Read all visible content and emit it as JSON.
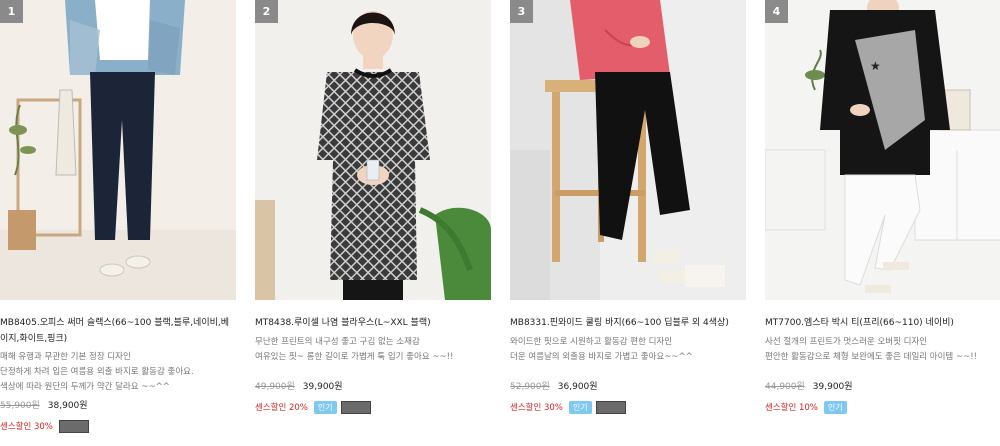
{
  "products": [
    {
      "rank": "1",
      "title": "MB8405.오피스 써머 슬랙스(66~100 블랙,블루,네이비,베이지,화이트,핑크)",
      "desc": [
        "매해 유행과 무관한 기본 정장 디자인",
        "단정하게 차려 입은 여름용 외출 바지로 활동감 좋아요.",
        "색상에 따라 원단의 두께가 약간 달라요 ~~^^"
      ],
      "old_price": "55,900원",
      "price": "38,900원",
      "discount": "센스할인 30%",
      "popular": "",
      "image": "woman-in-navy-slacks"
    },
    {
      "rank": "2",
      "title": "MT8438.루이셀 나염 블라우스(L~XXL 블랙)",
      "desc": [
        "무난한 프린트의 내구성 좋고 구김 없는 소재감",
        "여유있는 핏~ 롱한 길이로 가볍게 툭 입기 좋아요 ~~!!"
      ],
      "old_price": "49,900원",
      "price": "39,900원",
      "discount": "센스할인 20%",
      "popular": "인기",
      "image": "woman-in-checked-blouse"
    },
    {
      "rank": "3",
      "title": "MB8331.핀와이드 쿨링 바지(66~100 딥블루 외 4색상)",
      "desc": [
        "와이드한 핏으로 시원하고 활동감 편한 디자인",
        "더운 여름날의 외출용 바지로 가볍고 좋아요~~^^"
      ],
      "old_price": "52,900원",
      "price": "36,900원",
      "discount": "센스할인 30%",
      "popular": "인기",
      "image": "woman-in-wide-black-pants"
    },
    {
      "rank": "4",
      "title": "MT7700.엠스타 박시 티(프리(66~110) 네이비)",
      "desc": [
        "사선 절개의 프린트가 멋스러운 오버핏 디자인",
        "편안한 활동감으로 체형 보완에도 좋은 데일리 아이템 ~~!!"
      ],
      "old_price": "44,900원",
      "price": "39,900원",
      "discount": "센스할인 10%",
      "popular": "인기",
      "image": "woman-in-star-print-tee"
    }
  ]
}
